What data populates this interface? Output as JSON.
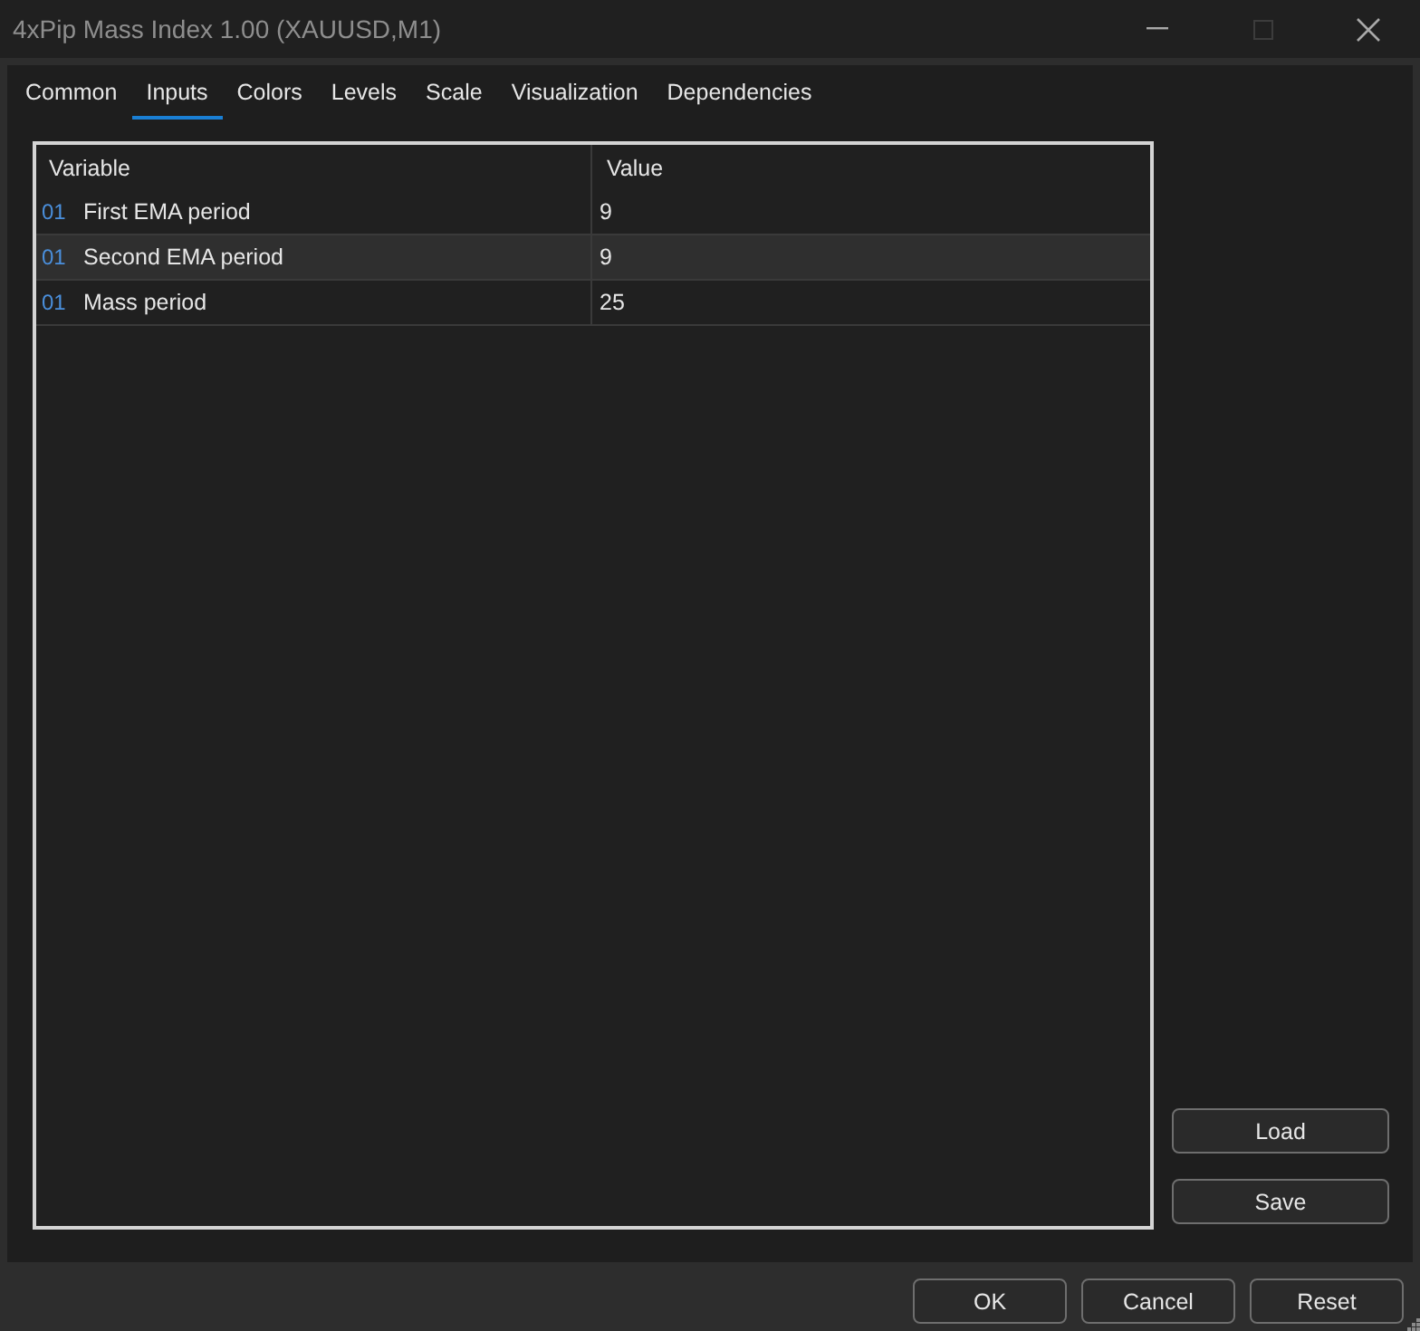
{
  "window": {
    "title": "4xPip Mass Index 1.00 (XAUUSD,M1)",
    "controls": [
      {
        "kind": "minimize",
        "disabled": false
      },
      {
        "kind": "maximize",
        "disabled": true
      },
      {
        "kind": "close",
        "disabled": false
      }
    ]
  },
  "tabs": [
    {
      "label": "Common",
      "selected": false
    },
    {
      "label": "Inputs",
      "selected": true
    },
    {
      "label": "Colors",
      "selected": false
    },
    {
      "label": "Levels",
      "selected": false
    },
    {
      "label": "Scale",
      "selected": false
    },
    {
      "label": "Visualization",
      "selected": false
    },
    {
      "label": "Dependencies",
      "selected": false
    }
  ],
  "table": {
    "columns": [
      "Variable",
      "Value"
    ],
    "rows": [
      {
        "type_icon": "01",
        "variable": "First EMA period",
        "value": "9",
        "selected": false
      },
      {
        "type_icon": "01",
        "variable": "Second EMA period",
        "value": "9",
        "selected": true
      },
      {
        "type_icon": "01",
        "variable": "Mass period",
        "value": "25",
        "selected": false
      }
    ]
  },
  "side_buttons": [
    "Load",
    "Save"
  ],
  "buttons": [
    "OK",
    "Cancel",
    "Reset"
  ]
}
